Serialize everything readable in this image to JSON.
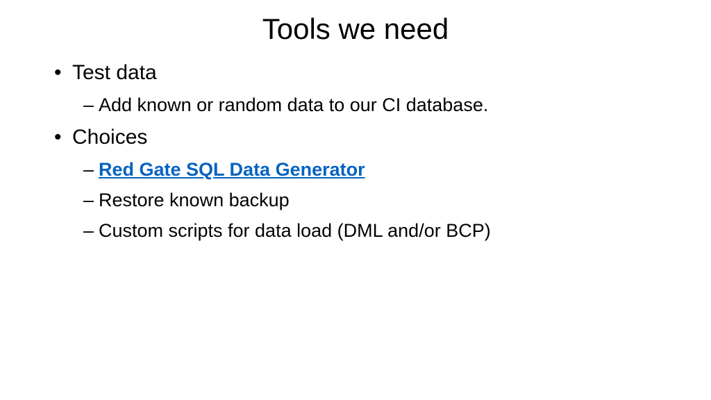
{
  "slide": {
    "title": "Tools we need",
    "bullets": [
      {
        "label": "Test data",
        "subitems": [
          {
            "text": "Add known or random data to our CI database.",
            "isLink": false
          }
        ]
      },
      {
        "label": "Choices",
        "subitems": [
          {
            "text": "Red Gate SQL Data Generator",
            "isLink": true
          },
          {
            "text": "Restore known backup",
            "isLink": false
          },
          {
            "text": "Custom scripts for data load (DML and/or BCP)",
            "isLink": false
          }
        ]
      }
    ]
  }
}
